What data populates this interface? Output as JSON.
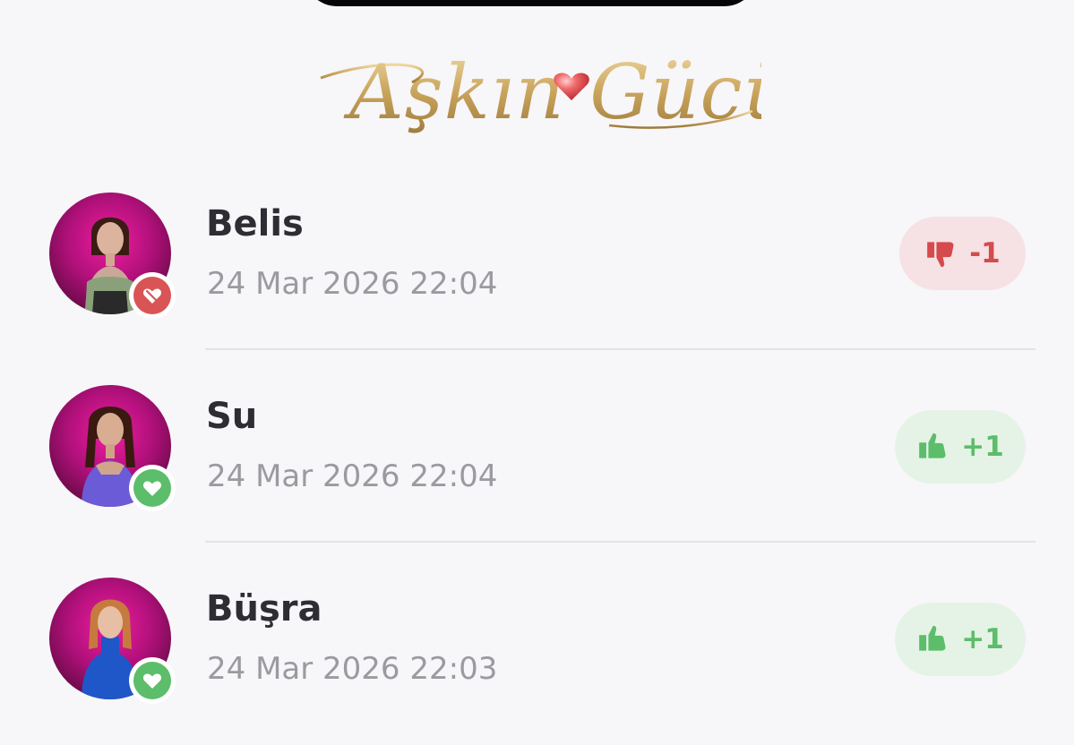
{
  "app": {
    "logo_text": "Aşkın Gücü"
  },
  "feed": [
    {
      "name": "Belis",
      "time": "24 Mar 2026 22:04",
      "vote": "-1",
      "vote_type": "negative",
      "status_icon": "broken-heart-icon"
    },
    {
      "name": "Su",
      "time": "24 Mar 2026 22:04",
      "vote": "+1",
      "vote_type": "positive",
      "status_icon": "heart-icon"
    },
    {
      "name": "Büşra",
      "time": "24 Mar 2026 22:03",
      "vote": "+1",
      "vote_type": "positive",
      "status_icon": "heart-icon"
    }
  ],
  "colors": {
    "background": "#f7f6f9",
    "negative": "#d54a4c",
    "negative_bg": "#f6e1e4",
    "positive": "#5cbd6a",
    "positive_bg": "#e5f3e6",
    "avatar_bg": "#c0127f",
    "logo_gold": "#c9a45c"
  }
}
